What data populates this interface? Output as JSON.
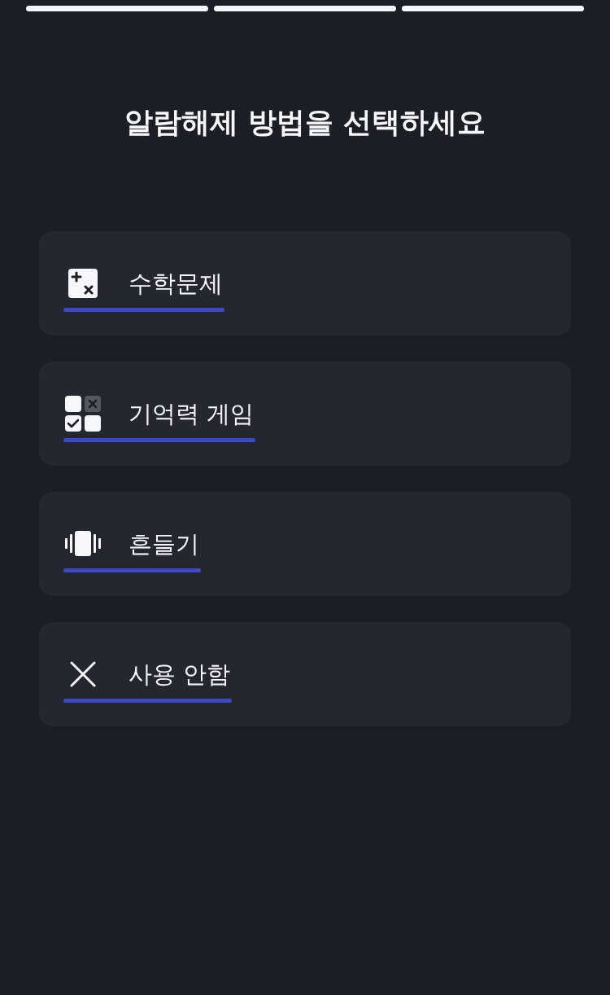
{
  "progress_steps": [
    {
      "done": true
    },
    {
      "done": true
    },
    {
      "done": true
    }
  ],
  "title": "알람해제 방법을 선택하세요",
  "options": [
    {
      "kind": "math",
      "label": "수학문제"
    },
    {
      "kind": "memory",
      "label": "기억력 게임"
    },
    {
      "kind": "shake",
      "label": "흔들기"
    },
    {
      "kind": "none",
      "label": "사용 안함"
    }
  ]
}
